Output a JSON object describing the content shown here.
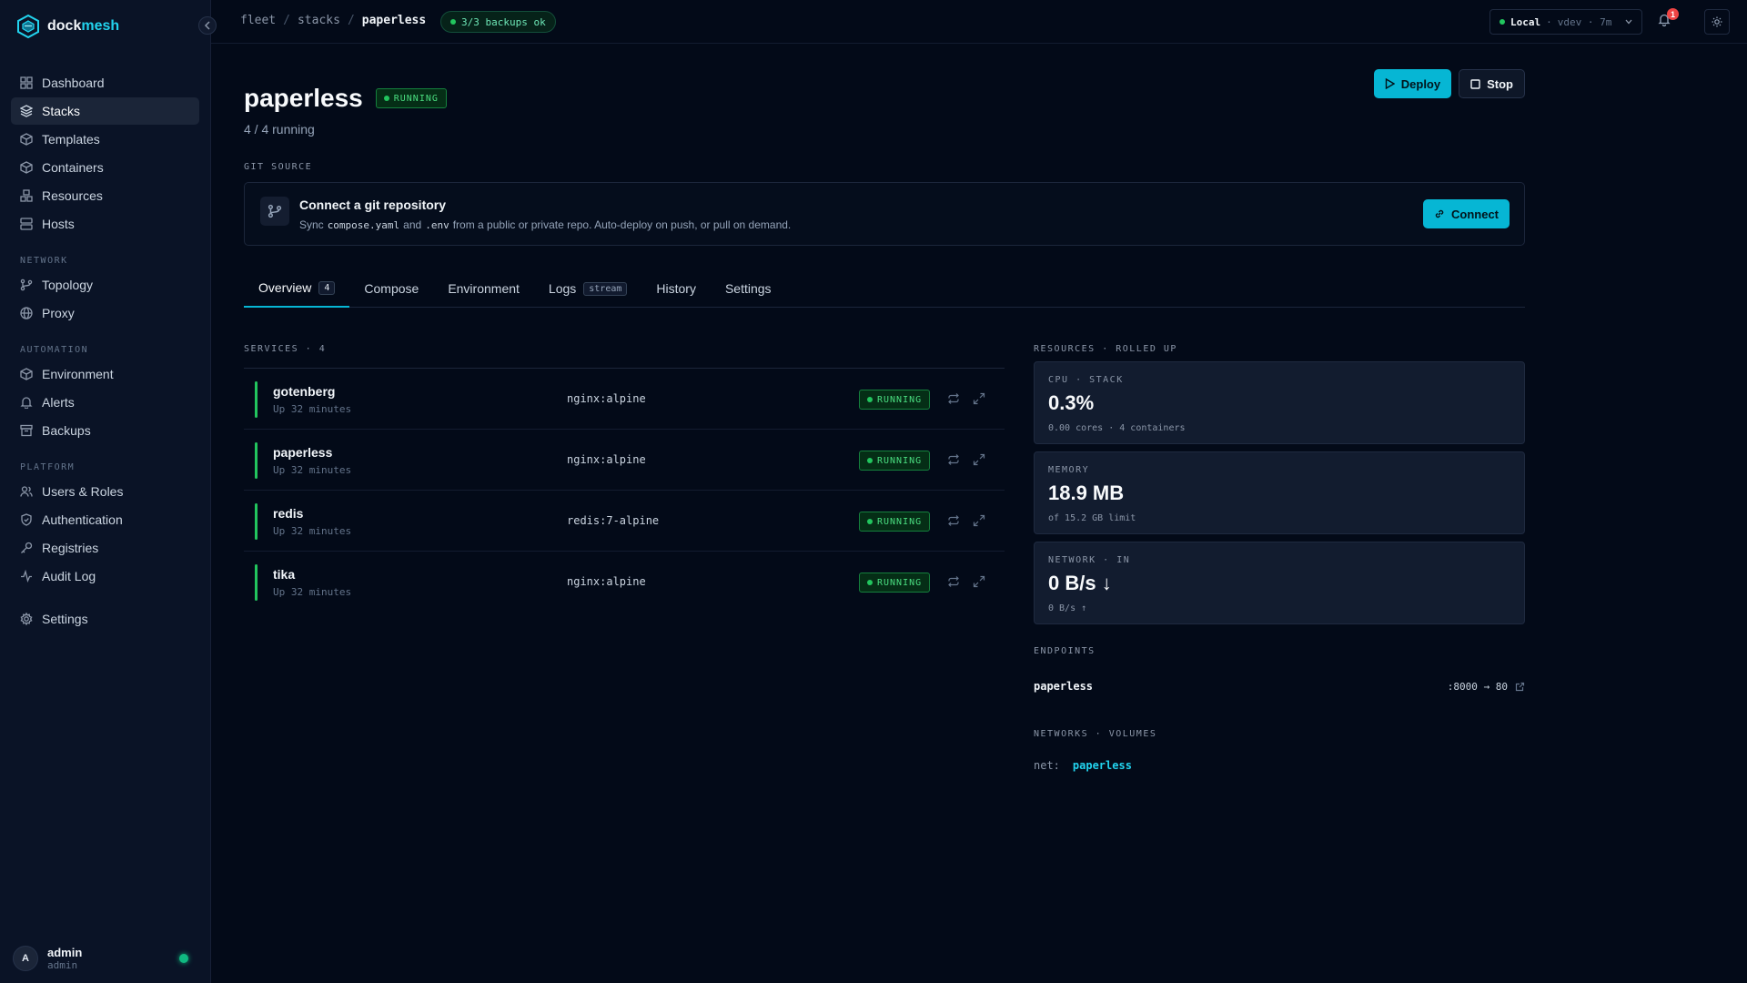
{
  "app": {
    "brand_prefix": "dock",
    "brand_suffix": "mesh"
  },
  "sidebar": {
    "main_items": [
      {
        "label": "Dashboard"
      },
      {
        "label": "Stacks"
      },
      {
        "label": "Templates"
      },
      {
        "label": "Containers"
      },
      {
        "label": "Resources"
      },
      {
        "label": "Hosts"
      }
    ],
    "network_label": "NETWORK",
    "network_items": [
      {
        "label": "Topology"
      },
      {
        "label": "Proxy"
      }
    ],
    "automation_label": "AUTOMATION",
    "automation_items": [
      {
        "label": "Environment"
      },
      {
        "label": "Alerts"
      },
      {
        "label": "Backups"
      }
    ],
    "platform_label": "PLATFORM",
    "platform_items": [
      {
        "label": "Users & Roles"
      },
      {
        "label": "Authentication"
      },
      {
        "label": "Registries"
      },
      {
        "label": "Audit Log"
      }
    ],
    "settings_label": "Settings",
    "user": {
      "initial": "A",
      "name": "admin",
      "role": "admin"
    }
  },
  "topbar": {
    "crumbs": [
      "fleet",
      "stacks",
      "paperless"
    ],
    "backup_badge": "3/3 backups ok",
    "host_name": "Local",
    "host_meta": "vdev · 7m",
    "notification_count": "1"
  },
  "page": {
    "title": "paperless",
    "status": "RUNNING",
    "subtitle": "4 / 4 running",
    "deploy_label": "Deploy",
    "stop_label": "Stop"
  },
  "git": {
    "section_label": "GIT SOURCE",
    "title": "Connect a git repository",
    "desc_prefix": "Sync",
    "file1": "compose.yaml",
    "desc_and": "and",
    "file2": ".env",
    "desc_suffix": "from a public or private repo. Auto-deploy on push, or pull on demand.",
    "connect_label": "Connect"
  },
  "tabs": [
    {
      "label": "Overview",
      "badge": "4"
    },
    {
      "label": "Compose"
    },
    {
      "label": "Environment"
    },
    {
      "label": "Logs",
      "badge": "stream"
    },
    {
      "label": "History"
    },
    {
      "label": "Settings"
    }
  ],
  "services": {
    "section_label": "SERVICES · 4",
    "rows": [
      {
        "name": "gotenberg",
        "uptime": "Up 32 minutes",
        "image": "nginx:alpine",
        "status": "RUNNING"
      },
      {
        "name": "paperless",
        "uptime": "Up 32 minutes",
        "image": "nginx:alpine",
        "status": "RUNNING"
      },
      {
        "name": "redis",
        "uptime": "Up 32 minutes",
        "image": "redis:7-alpine",
        "status": "RUNNING"
      },
      {
        "name": "tika",
        "uptime": "Up 32 minutes",
        "image": "nginx:alpine",
        "status": "RUNNING"
      }
    ]
  },
  "resources": {
    "section_label": "RESOURCES · ROLLED UP",
    "cpu": {
      "label": "CPU · STACK",
      "value": "0.3%",
      "sub": "0.00 cores · 4 containers"
    },
    "memory": {
      "label": "MEMORY",
      "value": "18.9 MB",
      "sub": "of 15.2 GB limit"
    },
    "network": {
      "label": "NETWORK · IN",
      "value": "0 B/s",
      "arrow": "↓",
      "sub": "0 B/s ↑"
    }
  },
  "endpoints": {
    "section_label": "ENDPOINTS",
    "items": [
      {
        "name": "paperless",
        "port": ":8000 → 80"
      }
    ]
  },
  "networks": {
    "section_label": "NETWORKS · VOLUMES",
    "key": "net:",
    "value": "paperless"
  },
  "colors": {
    "accent": "#06b6d4",
    "running": "#22c55e",
    "background": "#030a18",
    "sidebar": "#0a1326"
  }
}
